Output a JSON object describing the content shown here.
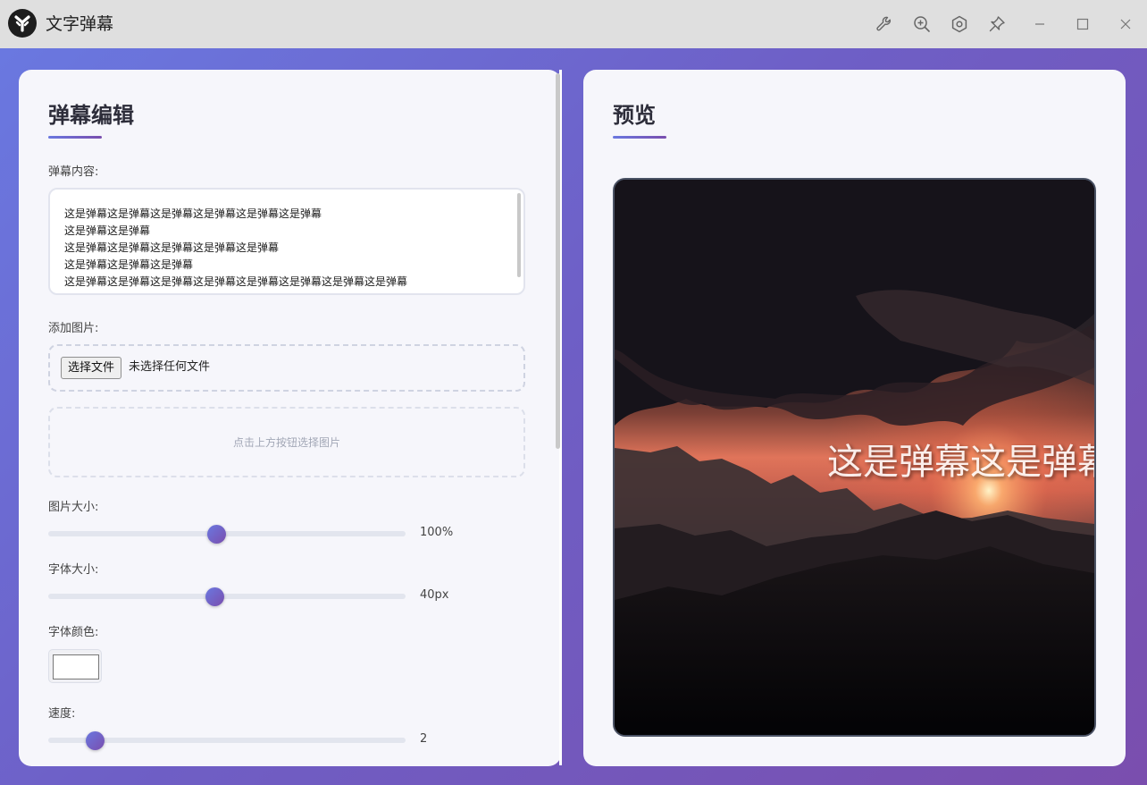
{
  "window": {
    "title": "文字弹幕",
    "controls": {
      "tools_icon": "wrench-icon",
      "zoom_icon": "zoom-in-icon",
      "settings_icon": "hexagon-gear-icon",
      "pin_icon": "pin-icon",
      "minimize_icon": "minimize-icon",
      "maximize_icon": "maximize-icon",
      "close_icon": "close-icon"
    }
  },
  "theme": {
    "gradient_start": "#6a78e0",
    "gradient_end": "#7a4eae",
    "panel_bg": "#f6f6fb"
  },
  "editor": {
    "title": "弹幕编辑",
    "content_label": "弹幕内容:",
    "content_lines": [
      "这是弹幕这是弹幕这是弹幕这是弹幕这是弹幕这是弹幕",
      "这是弹幕这是弹幕",
      "这是弹幕这是弹幕这是弹幕这是弹幕这是弹幕",
      "这是弹幕这是弹幕这是弹幕",
      "这是弹幕这是弹幕这是弹幕这是弹幕这是弹幕这是弹幕这是弹幕这是弹幕"
    ],
    "image_label": "添加图片:",
    "file_button": "选择文件",
    "file_status": "未选择任何文件",
    "image_hint": "点击上方按钮选择图片",
    "image_size": {
      "label": "图片大小:",
      "value": "100%",
      "fraction": 0.47
    },
    "font_size": {
      "label": "字体大小:",
      "value": "40px",
      "fraction": 0.465
    },
    "font_color": {
      "label": "字体颜色:",
      "value": "#ffffff"
    },
    "speed": {
      "label": "速度:",
      "value": "2",
      "fraction": 0.13
    }
  },
  "preview": {
    "title": "预览",
    "danmaku_text": "这是弹幕这是弹幕这是弹幕这是弹幕这是弹幕这是弹幕"
  }
}
